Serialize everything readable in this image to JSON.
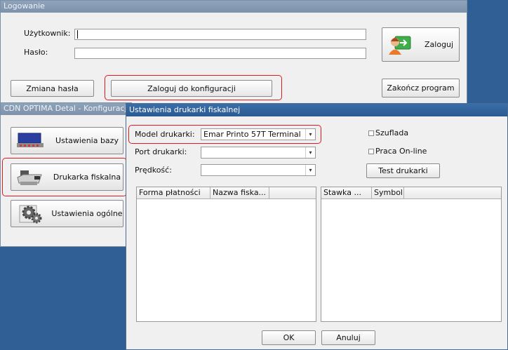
{
  "login": {
    "title": "Logowanie",
    "user_label": "Użytkownik:",
    "user_value": "",
    "password_label": "Hasło:",
    "password_value": "",
    "login_button": "Zaloguj",
    "change_password_button": "Zmiana hasła",
    "config_login_button": "Zaloguj do konfiguracji",
    "exit_button": "Zakończ program"
  },
  "config": {
    "title": "CDN OPTIMA Detal - Konfiguracja",
    "nav": [
      {
        "label": "Ustawienia bazy",
        "icon": "database-settings-icon"
      },
      {
        "label": "Drukarka fiskalna",
        "icon": "fiscal-printer-icon"
      },
      {
        "label": "Ustawienia ogólne",
        "icon": "gears-icon"
      }
    ]
  },
  "printer": {
    "title": "Ustawienia drukarki fiskalnej",
    "model_label": "Model drukarki:",
    "model_value": "Emar Printo 57T Terminal",
    "port_label": "Port drukarki:",
    "port_value": "",
    "speed_label": "Prędkość:",
    "speed_value": "",
    "drawer_label": "Szuflada",
    "online_label": "Praca On-line",
    "test_button": "Test drukarki",
    "payments_columns": [
      "Forma płatności",
      "Nazwa fiska..."
    ],
    "vat_columns": [
      "Stawka ...",
      "Symbol"
    ],
    "ok_button": "OK",
    "cancel_button": "Anuluj"
  },
  "colors": {
    "highlight": "#e0191f",
    "desktop": "#2f5f95",
    "title_active": "#3a6ea8"
  }
}
